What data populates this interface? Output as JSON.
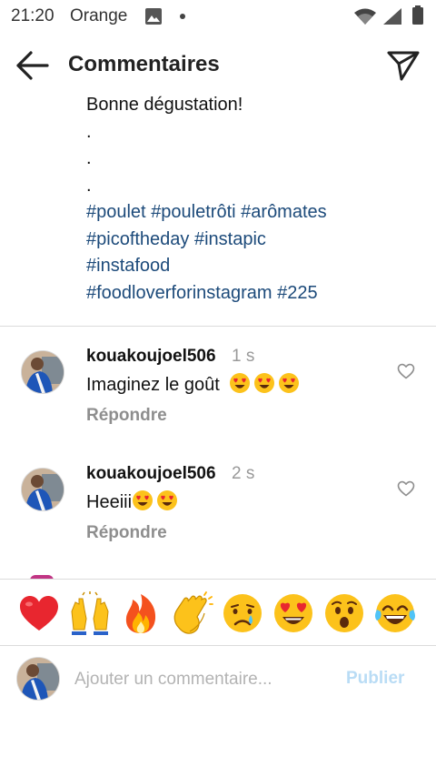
{
  "status_bar": {
    "time": "21:20",
    "carrier": "Orange",
    "icons": [
      "image-icon",
      "dot-icon",
      "wifi-icon",
      "signal-icon",
      "battery-icon"
    ]
  },
  "header": {
    "title": "Commentaires",
    "back_icon": "arrow-left-icon",
    "share_icon": "send-icon"
  },
  "caption": {
    "lines": [
      "Bonne dégustation!",
      ".",
      ".",
      "."
    ],
    "hashtag_lines": [
      [
        "#poulet",
        "#pouletrôti",
        "#arômates"
      ],
      [
        "#picoftheday",
        "#instapic"
      ],
      [
        "#instafood"
      ],
      [
        "#foodloverforinstagram",
        "#225"
      ]
    ]
  },
  "comments": [
    {
      "username": "kouakoujoel506",
      "time": "1 s",
      "text": "Imaginez le goût",
      "emojis": [
        "heart-eyes-emoji",
        "heart-eyes-emoji",
        "heart-eyes-emoji"
      ],
      "reply_label": "Répondre",
      "like_icon": "heart-outline-icon"
    },
    {
      "username": "kouakoujoel506",
      "time": "2 s",
      "text": "Heeiii",
      "emojis": [
        "heart-eyes-emoji",
        "heart-eyes-emoji"
      ],
      "reply_label": "Répondre",
      "like_icon": "heart-outline-icon"
    }
  ],
  "quick_reactions": [
    "red-heart-emoji",
    "raising-hands-emoji",
    "fire-emoji",
    "clapping-hands-emoji",
    "crying-face-emoji",
    "heart-eyes-emoji",
    "astonished-face-emoji",
    "tears-of-joy-emoji"
  ],
  "composer": {
    "placeholder": "Ajouter un commentaire...",
    "value": "",
    "post_label": "Publier"
  },
  "colors": {
    "hashtag": "#1c4a7a",
    "muted_text": "#8e8e8e",
    "timestamp": "#999999",
    "post_disabled": "#b9dcf5",
    "divider": "#dbdbdb",
    "heart_red": "#e8262f",
    "emoji_yellow": "#fcc21b"
  }
}
